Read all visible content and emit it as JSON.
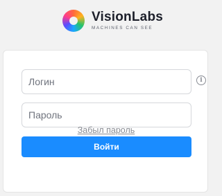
{
  "logo": {
    "brand": "VisionLabs",
    "tagline": "MACHINES CAN SEE"
  },
  "form": {
    "login_placeholder": "Логин",
    "password_placeholder": "Пароль",
    "submit_label": "Войти",
    "forgot_link": "Забыл пароль",
    "info_icon_glyph": "i"
  },
  "colors": {
    "primary": "#1a8cff",
    "background": "#f2f2f2"
  }
}
